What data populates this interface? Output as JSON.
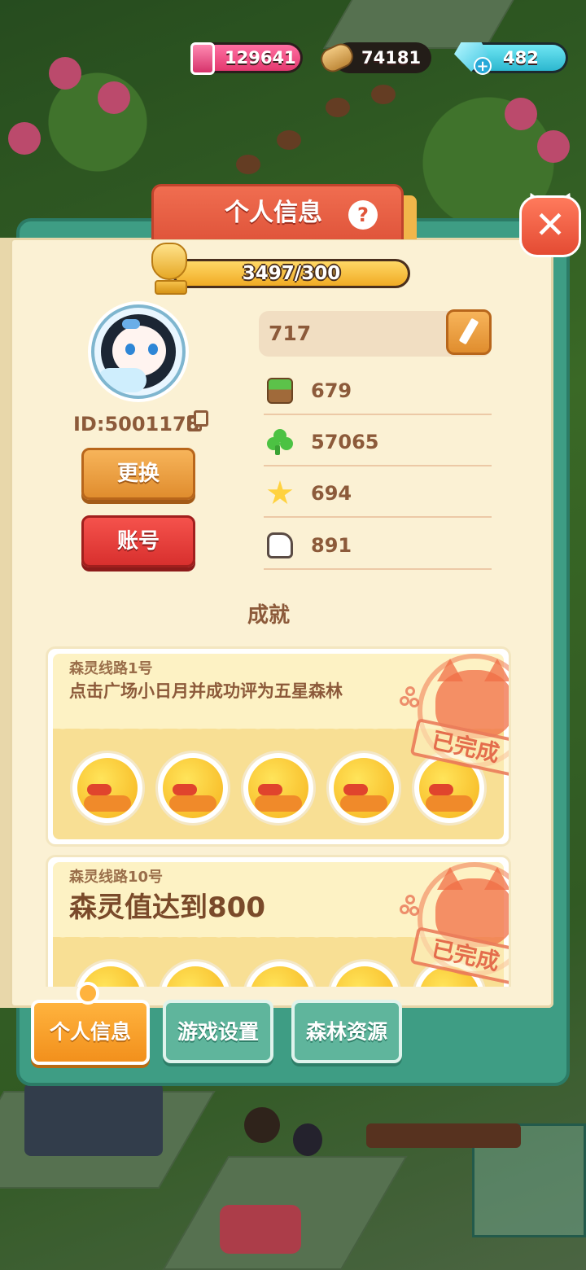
{
  "resources": {
    "ink": "129641",
    "wood": "74181",
    "gems": "482"
  },
  "panel": {
    "title": "个人信息",
    "help_icon": "?",
    "close_icon": "✕"
  },
  "level": {
    "progress_text": "3497/300",
    "progress_fraction": 1.0
  },
  "profile": {
    "user_id": "ID:5001178",
    "name": "717",
    "change_button": "更换",
    "account_button": "账号"
  },
  "stats": [
    {
      "icon": "grass-block-icon",
      "value": "679"
    },
    {
      "icon": "clover-icon",
      "value": "57065"
    },
    {
      "icon": "star-icon",
      "value": "694"
    },
    {
      "icon": "thumbs-up-icon",
      "value": "891"
    }
  ],
  "achievements": {
    "heading": "成就",
    "items": [
      {
        "subtitle": "森灵线路1号",
        "description": "点击广场小日月并成功评为五星森林",
        "status": "已完成"
      },
      {
        "subtitle": "森灵线路10号",
        "description": "森灵值达到800",
        "status": "已完成"
      }
    ]
  },
  "tabs": {
    "profile": "个人信息",
    "settings": "游戏设置",
    "forest": "森林资源"
  },
  "colors": {
    "panel_frame": "#3e9d84",
    "paper": "#fbf1d4",
    "title_tab": "#e0553b",
    "active_tab": "#f2901c",
    "inactive_tab": "#5fb59c",
    "text_brown": "#8c5a3a"
  }
}
